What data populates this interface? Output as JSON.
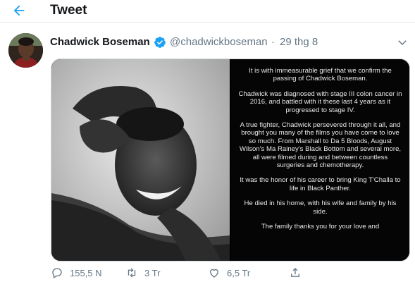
{
  "header": {
    "title": "Tweet",
    "back_icon": "arrow-left-icon"
  },
  "tweet": {
    "author": {
      "name": "Chadwick Boseman",
      "handle": "@chadwickboseman",
      "verified": true,
      "separator": "·",
      "date": "29 thg 8"
    },
    "statement": [
      "It is with immeasurable grief that we confirm the passing of Chadwick Boseman.",
      "Chadwick was diagnosed with stage III colon cancer in 2016, and battled with it these last 4 years as it progressed to stage IV.",
      "A true fighter, Chadwick persevered through it all, and brought you many of the films you have come to love so much. From Marshall to Da 5 Bloods, August Wilson's Ma Rainey's Black Bottom and several more, all were filmed during and between countless surgeries and chemotherapy.",
      "It was the honor of his career to bring King T'Challa to life in Black Panther.",
      "He died in his home, with his wife and family by his side.",
      "The family thanks you for your love and"
    ],
    "actions": {
      "reply_count": "155,5 N",
      "retweet_count": "3 Tr",
      "like_count": "6,5 Tr"
    }
  },
  "colors": {
    "accent": "#1da1f2",
    "muted": "#657786"
  }
}
